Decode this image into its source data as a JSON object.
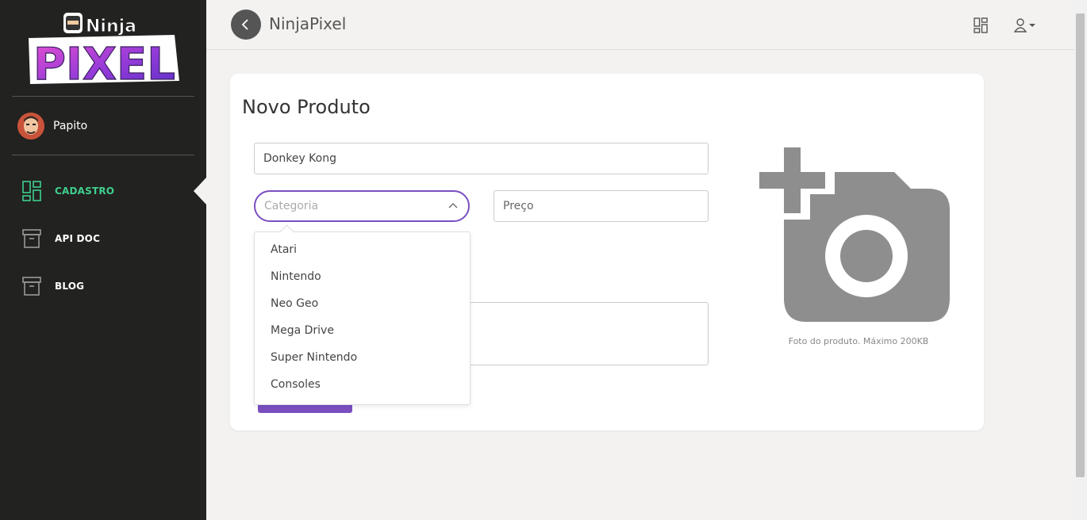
{
  "sidebar": {
    "logo_text": "Ninja PIXEL",
    "user_name": "Papito",
    "nav": [
      {
        "label": "CADASTRO",
        "icon": "dashboard-icon",
        "active": true
      },
      {
        "label": "API DOC",
        "icon": "archive-icon",
        "active": false
      },
      {
        "label": "BLOG",
        "icon": "archive-icon",
        "active": false
      }
    ]
  },
  "header": {
    "title": "NinjaPixel",
    "grid_icon": "grid-icon",
    "user_icon": "user-icon"
  },
  "form": {
    "title": "Novo Produto",
    "name_value": "Donkey Kong",
    "category_placeholder": "Categoria",
    "price_placeholder": "Preço",
    "category_options": [
      "Atari",
      "Nintendo",
      "Neo Geo",
      "Mega Drive",
      "Super Nintendo",
      "Consoles"
    ],
    "photo_caption": "Foto do produto. Máximo 200KB"
  },
  "colors": {
    "sidebar_bg": "#222220",
    "accent_purple": "#7a4fc0",
    "active_green": "#3fcf8e"
  }
}
